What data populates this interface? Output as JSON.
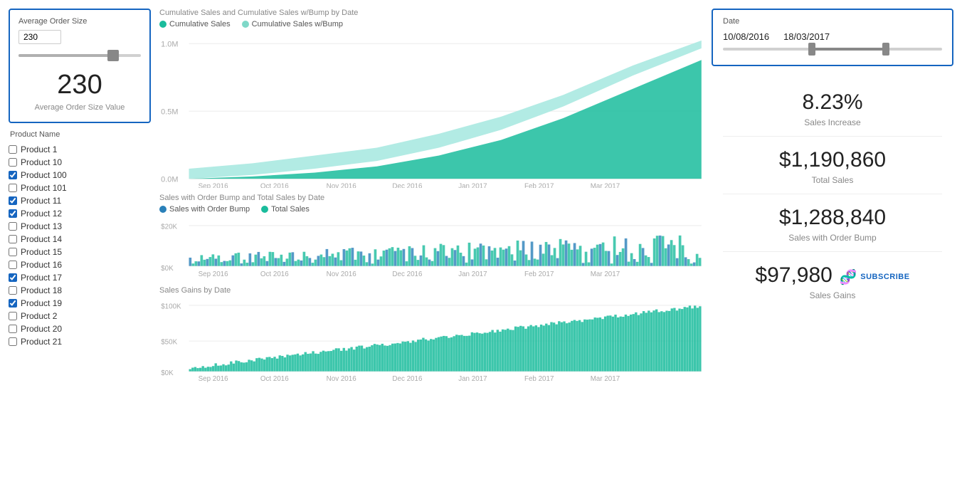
{
  "avgOrder": {
    "title": "Average Order Size",
    "inputValue": "230",
    "sliderValue": 230,
    "displayValue": "230",
    "label": "Average Order Size Value"
  },
  "productList": {
    "title": "Product Name",
    "items": [
      {
        "name": "Product 1",
        "checked": false
      },
      {
        "name": "Product 10",
        "checked": false
      },
      {
        "name": "Product 100",
        "checked": true
      },
      {
        "name": "Product 101",
        "checked": false
      },
      {
        "name": "Product 11",
        "checked": true
      },
      {
        "name": "Product 12",
        "checked": true
      },
      {
        "name": "Product 13",
        "checked": false
      },
      {
        "name": "Product 14",
        "checked": false
      },
      {
        "name": "Product 15",
        "checked": false
      },
      {
        "name": "Product 16",
        "checked": false
      },
      {
        "name": "Product 17",
        "checked": true
      },
      {
        "name": "Product 18",
        "checked": false
      },
      {
        "name": "Product 19",
        "checked": true
      },
      {
        "name": "Product 2",
        "checked": false
      },
      {
        "name": "Product 20",
        "checked": false
      },
      {
        "name": "Product 21",
        "checked": false
      }
    ]
  },
  "chart1": {
    "title": "Cumulative Sales and Cumulative Sales w/Bump by Date",
    "legend": [
      {
        "label": "Cumulative Sales",
        "color": "#1abc9c"
      },
      {
        "label": "Cumulative Sales w/Bump",
        "color": "#7fd8c8"
      }
    ],
    "xLabels": [
      "Sep 2016",
      "Oct 2016",
      "Nov 2016",
      "Dec 2016",
      "Jan 2017",
      "Feb 2017",
      "Mar 2017"
    ],
    "yLabels": [
      "1.0M",
      "0.5M",
      "0.0M"
    ]
  },
  "chart2": {
    "title": "Sales with Order Bump and Total Sales by Date",
    "legend": [
      {
        "label": "Sales with Order Bump",
        "color": "#2980b9"
      },
      {
        "label": "Total Sales",
        "color": "#1abc9c"
      }
    ],
    "xLabels": [
      "Sep 2016",
      "Oct 2016",
      "Nov 2016",
      "Dec 2016",
      "Jan 2017",
      "Feb 2017",
      "Mar 2017"
    ],
    "yLabels": [
      "$20K",
      "$0K"
    ]
  },
  "chart3": {
    "title": "Sales Gains by Date",
    "xLabels": [
      "Sep 2016",
      "Oct 2016",
      "Nov 2016",
      "Dec 2016",
      "Jan 2017",
      "Feb 2017",
      "Mar 2017"
    ],
    "yLabels": [
      "$100K",
      "$50K",
      "$0K"
    ]
  },
  "dateFilter": {
    "title": "Date",
    "from": "10/08/2016",
    "to": "18/03/2017"
  },
  "kpis": [
    {
      "value": "8.23%",
      "label": "Sales Increase"
    },
    {
      "value": "$1,190,860",
      "label": "Total Sales"
    },
    {
      "value": "$1,288,840",
      "label": "Sales with Order Bump"
    },
    {
      "value": "$97,980",
      "label": "Sales Gains"
    }
  ],
  "subscribe": {
    "label": "SUBSCRIBE"
  }
}
